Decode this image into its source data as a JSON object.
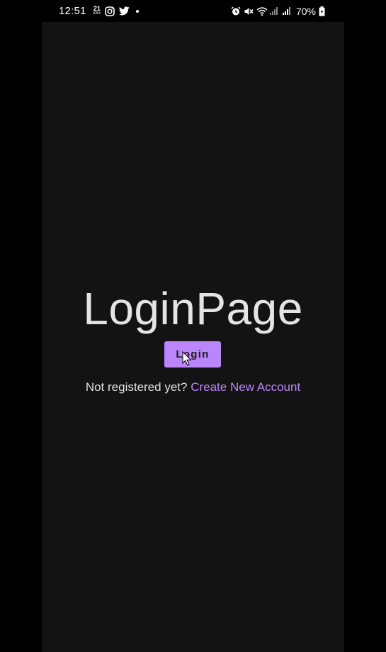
{
  "status_bar": {
    "time": "12:51",
    "net_speed_value": "21",
    "net_speed_unit": "KB/s",
    "left_icons": [
      "instagram-icon",
      "twitter-icon",
      "notification-dot"
    ],
    "right_icons": [
      "alarm-icon",
      "mute-icon",
      "wifi-icon",
      "signal-icon",
      "signal-icon-2",
      "battery-icon"
    ],
    "battery": "70%"
  },
  "main": {
    "title": "LoginPage",
    "login_button": "Login",
    "register_question": "Not registered yet?",
    "register_link": "Create New Account"
  },
  "colors": {
    "background": "#131313",
    "accent": "#bb86fc",
    "text": "#e4e4e4"
  }
}
